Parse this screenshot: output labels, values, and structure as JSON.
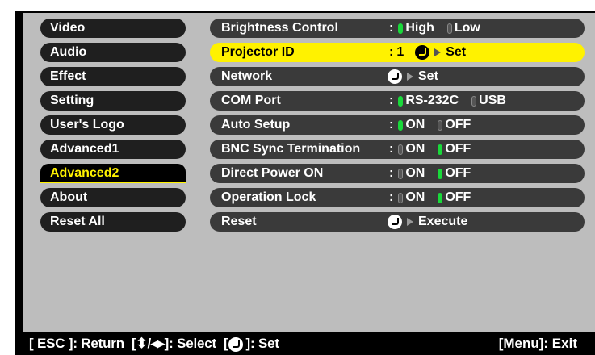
{
  "menu": [
    {
      "label": "Video",
      "active": false
    },
    {
      "label": "Audio",
      "active": false
    },
    {
      "label": "Effect",
      "active": false
    },
    {
      "label": "Setting",
      "active": false
    },
    {
      "label": "User's Logo",
      "active": false
    },
    {
      "label": "Advanced1",
      "active": false
    },
    {
      "label": "Advanced2",
      "active": true
    },
    {
      "label": "About",
      "active": false
    },
    {
      "label": "Reset All",
      "active": false
    }
  ],
  "rows": [
    {
      "label": "Brightness Control",
      "kind": "radio",
      "options": [
        {
          "text": "High",
          "on": true
        },
        {
          "text": "Low",
          "on": false
        }
      ]
    },
    {
      "label": "Projector ID",
      "kind": "id",
      "value": "1",
      "action": "Set",
      "highlighted": true
    },
    {
      "label": "Network",
      "kind": "enter",
      "action": "Set"
    },
    {
      "label": "COM Port",
      "kind": "radio",
      "options": [
        {
          "text": "RS-232C",
          "on": true
        },
        {
          "text": "USB",
          "on": false
        }
      ]
    },
    {
      "label": "Auto Setup",
      "kind": "radio",
      "options": [
        {
          "text": "ON",
          "on": true
        },
        {
          "text": "OFF",
          "on": false
        }
      ]
    },
    {
      "label": "BNC Sync Termination",
      "kind": "radio",
      "options": [
        {
          "text": "ON",
          "on": false
        },
        {
          "text": "OFF",
          "on": true
        }
      ]
    },
    {
      "label": "Direct Power ON",
      "kind": "radio",
      "options": [
        {
          "text": "ON",
          "on": false
        },
        {
          "text": "OFF",
          "on": true
        }
      ]
    },
    {
      "label": "Operation Lock",
      "kind": "radio",
      "options": [
        {
          "text": "ON",
          "on": false
        },
        {
          "text": "OFF",
          "on": true
        }
      ]
    },
    {
      "label": "Reset",
      "kind": "enter",
      "action": "Execute"
    }
  ],
  "status": {
    "esc": "[ ESC ]: Return",
    "select_open": "[",
    "select_close": "]: Select",
    "set_open": "[",
    "set_close": "]: Set",
    "exit": "[Menu]: Exit",
    "updown_glyph": "⬍",
    "leftright_glyph": "◂▸",
    "separator": "/"
  },
  "colors": {
    "highlight": "#fff200",
    "radio_on": "#19d93a",
    "panel": "#bdbdbd"
  }
}
